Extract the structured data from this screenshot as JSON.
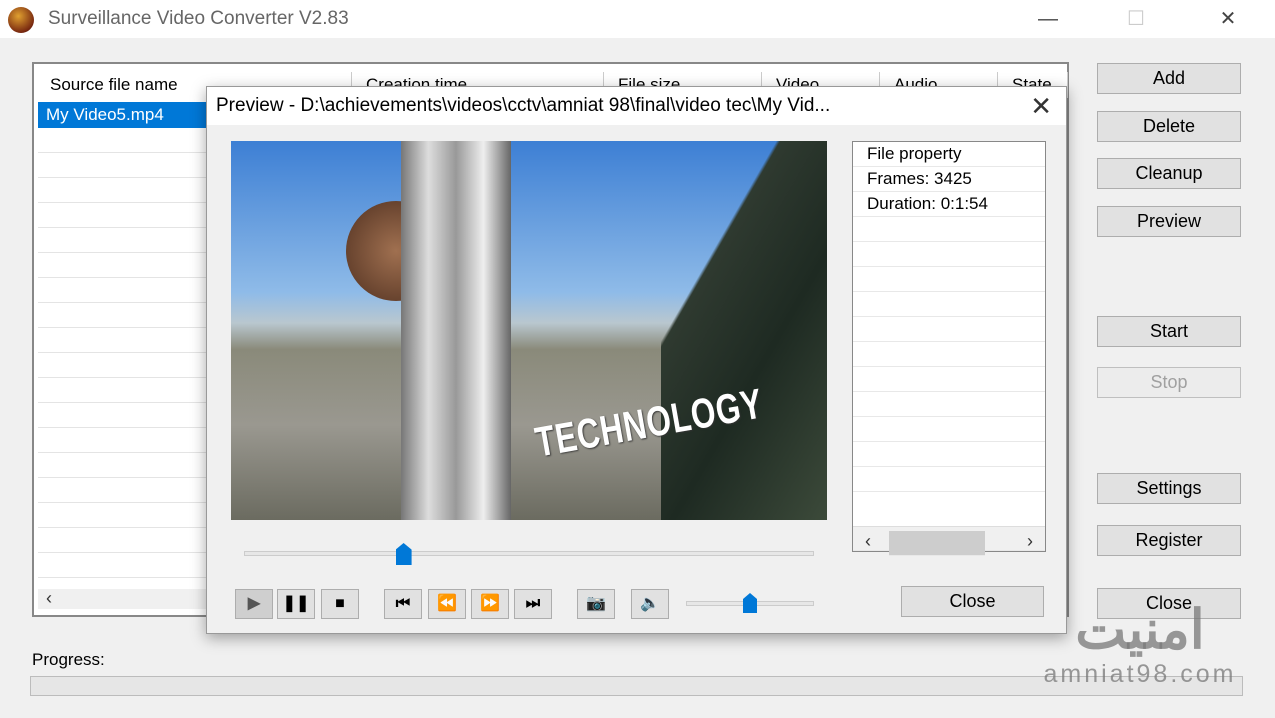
{
  "window": {
    "title": "Surveillance Video Converter V2.83",
    "minimize": "—",
    "maximize": "☐",
    "close": "✕"
  },
  "list": {
    "columns": [
      "Source file name",
      "Creation time",
      "File size",
      "Video",
      "Audio",
      "State"
    ],
    "rows": [
      {
        "name": "My Video5.mp4"
      }
    ]
  },
  "sidebar": {
    "buttons": [
      {
        "label": "Add",
        "enabled": true
      },
      {
        "label": "Delete",
        "enabled": true
      },
      {
        "label": "Cleanup",
        "enabled": true
      },
      {
        "label": "Preview",
        "enabled": true
      },
      {
        "label": "Start",
        "enabled": true
      },
      {
        "label": "Stop",
        "enabled": false
      },
      {
        "label": "Settings",
        "enabled": true
      },
      {
        "label": "Register",
        "enabled": true
      },
      {
        "label": "Close",
        "enabled": true
      }
    ]
  },
  "progress": {
    "label": "Progress:",
    "value": 0
  },
  "preview": {
    "title": "Preview - D:\\achievements\\videos\\cctv\\amniat 98\\final\\video tec\\My Vid...",
    "close_icon": "✕",
    "video_overlay_text": "TECHNOLOGY",
    "seek_position_fraction": 0.28,
    "volume_fraction": 0.5,
    "properties": [
      "File property",
      "Frames: 3425",
      "Duration: 0:1:54"
    ],
    "controls": [
      {
        "name": "play-button",
        "glyph": "▶",
        "icon": "play-icon"
      },
      {
        "name": "pause-button",
        "glyph": "❚❚",
        "icon": "pause-icon"
      },
      {
        "name": "stop-button",
        "glyph": "■",
        "icon": "stop-icon"
      },
      {
        "name": "first-frame-button",
        "glyph": "⏮",
        "icon": "skip-start-icon"
      },
      {
        "name": "rewind-button",
        "glyph": "⏪",
        "icon": "rewind-icon"
      },
      {
        "name": "fast-forward-button",
        "glyph": "⏩",
        "icon": "fast-forward-icon"
      },
      {
        "name": "last-frame-button",
        "glyph": "⏭",
        "icon": "skip-end-icon"
      },
      {
        "name": "snapshot-button",
        "glyph": "📷",
        "icon": "camera-icon"
      },
      {
        "name": "mute-button",
        "glyph": "🔈",
        "icon": "speaker-icon"
      }
    ],
    "close_label": "Close"
  },
  "watermark": {
    "arabic": "امنیت",
    "site": "amniat98.com"
  }
}
